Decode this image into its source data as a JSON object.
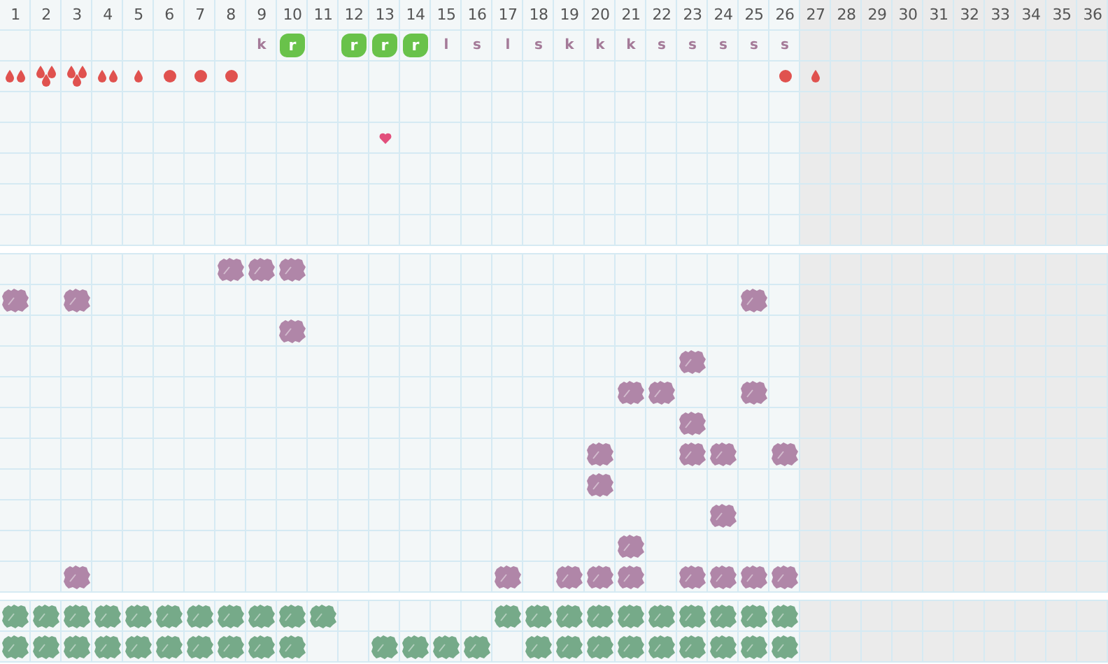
{
  "days": [
    {
      "label": "1",
      "greyed": false
    },
    {
      "label": "2",
      "greyed": false
    },
    {
      "label": "3",
      "greyed": false
    },
    {
      "label": "4",
      "greyed": false
    },
    {
      "label": "5",
      "greyed": false
    },
    {
      "label": "6",
      "greyed": false
    },
    {
      "label": "7",
      "greyed": false
    },
    {
      "label": "8",
      "greyed": false
    },
    {
      "label": "9",
      "greyed": false
    },
    {
      "label": "10",
      "greyed": false
    },
    {
      "label": "11",
      "greyed": false
    },
    {
      "label": "12",
      "greyed": false
    },
    {
      "label": "13",
      "greyed": false
    },
    {
      "label": "14",
      "greyed": false
    },
    {
      "label": "15",
      "greyed": false
    },
    {
      "label": "16",
      "greyed": false
    },
    {
      "label": "17",
      "greyed": false
    },
    {
      "label": "18",
      "greyed": false
    },
    {
      "label": "19",
      "greyed": false
    },
    {
      "label": "20",
      "greyed": false
    },
    {
      "label": "21",
      "greyed": false
    },
    {
      "label": "22",
      "greyed": false
    },
    {
      "label": "23",
      "greyed": false
    },
    {
      "label": "24",
      "greyed": false
    },
    {
      "label": "25",
      "greyed": false
    },
    {
      "label": "26",
      "greyed": false
    },
    {
      "label": "27",
      "greyed": true
    },
    {
      "label": "28",
      "greyed": true
    },
    {
      "label": "29",
      "greyed": true
    },
    {
      "label": "30",
      "greyed": true
    },
    {
      "label": "31",
      "greyed": true
    },
    {
      "label": "32",
      "greyed": true
    },
    {
      "label": "33",
      "greyed": true
    },
    {
      "label": "34",
      "greyed": true
    },
    {
      "label": "35",
      "greyed": true
    },
    {
      "label": "36",
      "greyed": true
    }
  ],
  "top_rows": [
    {
      "kind": "letters",
      "cells": [
        {
          "kind": "none"
        },
        {
          "kind": "none"
        },
        {
          "kind": "none"
        },
        {
          "kind": "none"
        },
        {
          "kind": "none"
        },
        {
          "kind": "none"
        },
        {
          "kind": "none"
        },
        {
          "kind": "none"
        },
        {
          "kind": "letter",
          "text": "k"
        },
        {
          "kind": "badge",
          "text": "r"
        },
        {
          "kind": "none"
        },
        {
          "kind": "badge",
          "text": "r"
        },
        {
          "kind": "badge",
          "text": "r"
        },
        {
          "kind": "badge",
          "text": "r"
        },
        {
          "kind": "letter",
          "text": "l"
        },
        {
          "kind": "letter",
          "text": "s"
        },
        {
          "kind": "letter",
          "text": "l"
        },
        {
          "kind": "letter",
          "text": "s"
        },
        {
          "kind": "letter",
          "text": "k"
        },
        {
          "kind": "letter",
          "text": "k"
        },
        {
          "kind": "letter",
          "text": "k"
        },
        {
          "kind": "letter",
          "text": "s"
        },
        {
          "kind": "letter",
          "text": "s"
        },
        {
          "kind": "letter",
          "text": "s"
        },
        {
          "kind": "letter",
          "text": "s"
        },
        {
          "kind": "letter",
          "text": "s"
        },
        {
          "kind": "none"
        },
        {
          "kind": "none"
        },
        {
          "kind": "none"
        },
        {
          "kind": "none"
        },
        {
          "kind": "none"
        },
        {
          "kind": "none"
        },
        {
          "kind": "none"
        },
        {
          "kind": "none"
        },
        {
          "kind": "none"
        },
        {
          "kind": "none"
        }
      ]
    },
    {
      "kind": "symbols",
      "cells": [
        {
          "kind": "medium"
        },
        {
          "kind": "heavy"
        },
        {
          "kind": "heavy"
        },
        {
          "kind": "medium"
        },
        {
          "kind": "light"
        },
        {
          "kind": "spot"
        },
        {
          "kind": "spot"
        },
        {
          "kind": "spot"
        },
        {
          "kind": "none"
        },
        {
          "kind": "none"
        },
        {
          "kind": "none"
        },
        {
          "kind": "none"
        },
        {
          "kind": "none"
        },
        {
          "kind": "none"
        },
        {
          "kind": "none"
        },
        {
          "kind": "none"
        },
        {
          "kind": "none"
        },
        {
          "kind": "none"
        },
        {
          "kind": "none"
        },
        {
          "kind": "none"
        },
        {
          "kind": "none"
        },
        {
          "kind": "none"
        },
        {
          "kind": "none"
        },
        {
          "kind": "none"
        },
        {
          "kind": "none"
        },
        {
          "kind": "spot"
        },
        {
          "kind": "light"
        },
        {
          "kind": "none"
        },
        {
          "kind": "none"
        },
        {
          "kind": "none"
        },
        {
          "kind": "none"
        },
        {
          "kind": "none"
        },
        {
          "kind": "none"
        },
        {
          "kind": "none"
        },
        {
          "kind": "none"
        },
        {
          "kind": "none"
        }
      ]
    },
    {
      "kind": "blank"
    },
    {
      "kind": "symbols",
      "cells": [
        {
          "kind": "none"
        },
        {
          "kind": "none"
        },
        {
          "kind": "none"
        },
        {
          "kind": "none"
        },
        {
          "kind": "none"
        },
        {
          "kind": "none"
        },
        {
          "kind": "none"
        },
        {
          "kind": "none"
        },
        {
          "kind": "none"
        },
        {
          "kind": "none"
        },
        {
          "kind": "none"
        },
        {
          "kind": "none"
        },
        {
          "kind": "heart"
        },
        {
          "kind": "none"
        },
        {
          "kind": "none"
        },
        {
          "kind": "none"
        },
        {
          "kind": "none"
        },
        {
          "kind": "none"
        },
        {
          "kind": "none"
        },
        {
          "kind": "none"
        },
        {
          "kind": "none"
        },
        {
          "kind": "none"
        },
        {
          "kind": "none"
        },
        {
          "kind": "none"
        },
        {
          "kind": "none"
        },
        {
          "kind": "none"
        },
        {
          "kind": "none"
        },
        {
          "kind": "none"
        },
        {
          "kind": "none"
        },
        {
          "kind": "none"
        },
        {
          "kind": "none"
        },
        {
          "kind": "none"
        },
        {
          "kind": "none"
        },
        {
          "kind": "none"
        },
        {
          "kind": "none"
        },
        {
          "kind": "none"
        }
      ]
    },
    {
      "kind": "blank"
    },
    {
      "kind": "blank"
    },
    {
      "kind": "blank"
    }
  ],
  "grid_rows": [
    {
      "cells": [
        false,
        false,
        false,
        false,
        false,
        false,
        false,
        true,
        true,
        true,
        false,
        false,
        false,
        false,
        false,
        false,
        false,
        false,
        false,
        false,
        false,
        false,
        false,
        false,
        false,
        false,
        false,
        false,
        false,
        false,
        false,
        false,
        false,
        false,
        false,
        false
      ]
    },
    {
      "cells": [
        true,
        false,
        true,
        false,
        false,
        false,
        false,
        false,
        false,
        false,
        false,
        false,
        false,
        false,
        false,
        false,
        false,
        false,
        false,
        false,
        false,
        false,
        false,
        false,
        true,
        false,
        false,
        false,
        false,
        false,
        false,
        false,
        false,
        false,
        false,
        false
      ]
    },
    {
      "cells": [
        false,
        false,
        false,
        false,
        false,
        false,
        false,
        false,
        false,
        true,
        false,
        false,
        false,
        false,
        false,
        false,
        false,
        false,
        false,
        false,
        false,
        false,
        false,
        false,
        false,
        false,
        false,
        false,
        false,
        false,
        false,
        false,
        false,
        false,
        false,
        false
      ]
    },
    {
      "cells": [
        false,
        false,
        false,
        false,
        false,
        false,
        false,
        false,
        false,
        false,
        false,
        false,
        false,
        false,
        false,
        false,
        false,
        false,
        false,
        false,
        false,
        false,
        true,
        false,
        false,
        false,
        false,
        false,
        false,
        false,
        false,
        false,
        false,
        false,
        false,
        false
      ]
    },
    {
      "cells": [
        false,
        false,
        false,
        false,
        false,
        false,
        false,
        false,
        false,
        false,
        false,
        false,
        false,
        false,
        false,
        false,
        false,
        false,
        false,
        false,
        true,
        true,
        false,
        false,
        true,
        false,
        false,
        false,
        false,
        false,
        false,
        false,
        false,
        false,
        false,
        false
      ]
    },
    {
      "cells": [
        false,
        false,
        false,
        false,
        false,
        false,
        false,
        false,
        false,
        false,
        false,
        false,
        false,
        false,
        false,
        false,
        false,
        false,
        false,
        false,
        false,
        false,
        true,
        false,
        false,
        false,
        false,
        false,
        false,
        false,
        false,
        false,
        false,
        false,
        false,
        false
      ]
    },
    {
      "cells": [
        false,
        false,
        false,
        false,
        false,
        false,
        false,
        false,
        false,
        false,
        false,
        false,
        false,
        false,
        false,
        false,
        false,
        false,
        false,
        true,
        false,
        false,
        true,
        true,
        false,
        true,
        false,
        false,
        false,
        false,
        false,
        false,
        false,
        false,
        false,
        false
      ]
    },
    {
      "cells": [
        false,
        false,
        false,
        false,
        false,
        false,
        false,
        false,
        false,
        false,
        false,
        false,
        false,
        false,
        false,
        false,
        false,
        false,
        false,
        true,
        false,
        false,
        false,
        false,
        false,
        false,
        false,
        false,
        false,
        false,
        false,
        false,
        false,
        false,
        false,
        false
      ]
    },
    {
      "cells": [
        false,
        false,
        false,
        false,
        false,
        false,
        false,
        false,
        false,
        false,
        false,
        false,
        false,
        false,
        false,
        false,
        false,
        false,
        false,
        false,
        false,
        false,
        false,
        true,
        false,
        false,
        false,
        false,
        false,
        false,
        false,
        false,
        false,
        false,
        false,
        false
      ]
    },
    {
      "cells": [
        false,
        false,
        false,
        false,
        false,
        false,
        false,
        false,
        false,
        false,
        false,
        false,
        false,
        false,
        false,
        false,
        false,
        false,
        false,
        false,
        true,
        false,
        false,
        false,
        false,
        false,
        false,
        false,
        false,
        false,
        false,
        false,
        false,
        false,
        false,
        false
      ]
    },
    {
      "cells": [
        false,
        false,
        true,
        false,
        false,
        false,
        false,
        false,
        false,
        false,
        false,
        false,
        false,
        false,
        false,
        false,
        true,
        false,
        true,
        true,
        true,
        false,
        true,
        true,
        true,
        true,
        false,
        false,
        false,
        false,
        false,
        false,
        false,
        false,
        false,
        false
      ]
    }
  ],
  "bottom_rows": [
    {
      "cells": [
        true,
        true,
        true,
        true,
        true,
        true,
        true,
        true,
        true,
        true,
        true,
        false,
        false,
        false,
        false,
        false,
        true,
        true,
        true,
        true,
        true,
        true,
        true,
        true,
        true,
        true,
        false,
        false,
        false,
        false,
        false,
        false,
        false,
        false,
        false,
        false
      ]
    },
    {
      "cells": [
        true,
        true,
        true,
        true,
        true,
        true,
        true,
        true,
        true,
        true,
        false,
        false,
        true,
        true,
        true,
        true,
        false,
        true,
        true,
        true,
        true,
        true,
        true,
        true,
        true,
        true,
        false,
        false,
        false,
        false,
        false,
        false,
        false,
        false,
        false,
        false
      ]
    }
  ]
}
